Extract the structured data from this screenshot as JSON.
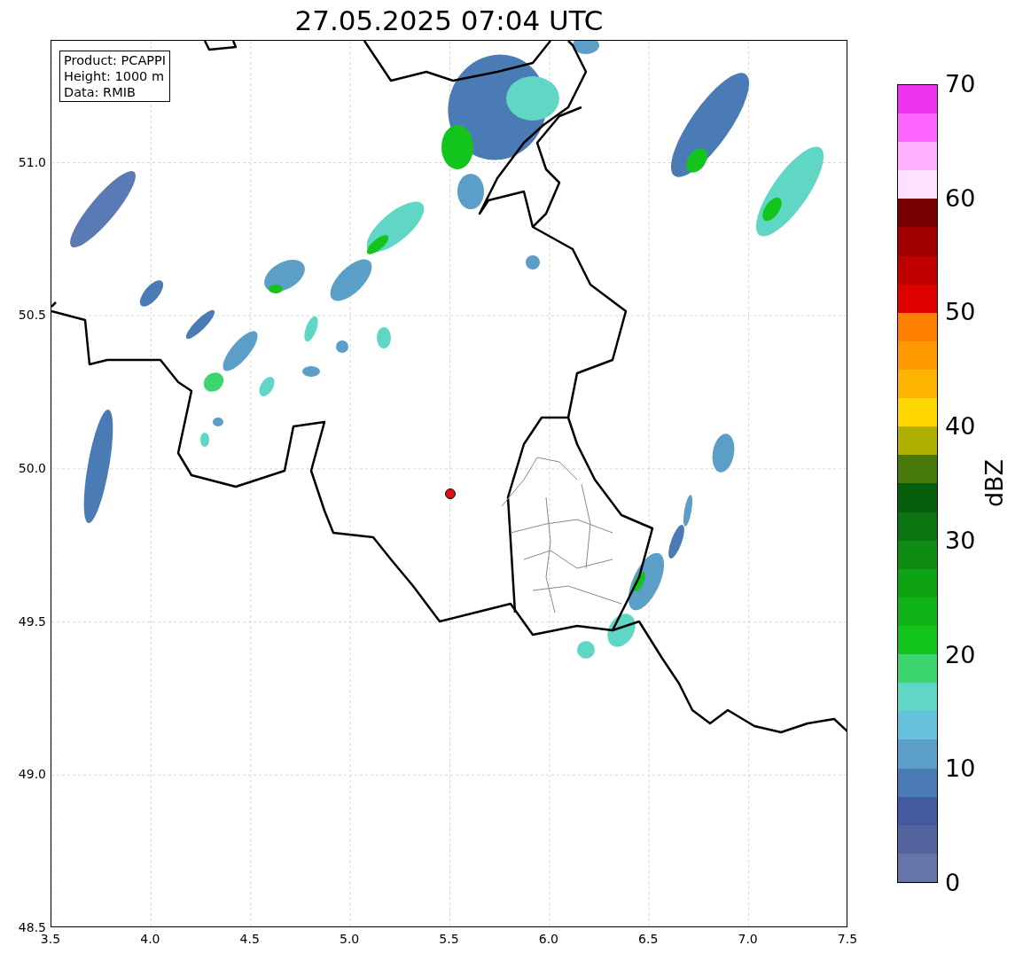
{
  "chart": {
    "title": "27.05.2025 07:04 UTC",
    "info_box": [
      "Product: PCAPPI",
      "Height: 1000 m",
      "Data: RMIB"
    ],
    "x_ticks": [
      "3.5",
      "4.0",
      "4.5",
      "5.0",
      "5.5",
      "6.0",
      "6.5",
      "7.0",
      "7.5"
    ],
    "y_ticks": [
      "51.0",
      "50.5",
      "50.0",
      "49.5",
      "49.0",
      "48.5"
    ]
  },
  "colorbar": {
    "label": "dBZ",
    "ticks": [
      "70",
      "60",
      "50",
      "40",
      "30",
      "20",
      "10",
      "0"
    ],
    "bands": [
      {
        "color": "#6675a8"
      },
      {
        "color": "#53649e"
      },
      {
        "color": "#435aa0"
      },
      {
        "color": "#4a7bb5"
      },
      {
        "color": "#5b9ec8"
      },
      {
        "color": "#65c1dc"
      },
      {
        "color": "#60d6c4"
      },
      {
        "color": "#3dd56f"
      },
      {
        "color": "#12c41c"
      },
      {
        "color": "#10b418"
      },
      {
        "color": "#0fa313"
      },
      {
        "color": "#0e8c12"
      },
      {
        "color": "#0a7410"
      },
      {
        "color": "#075e0d"
      },
      {
        "color": "#477a0a"
      },
      {
        "color": "#b0b000"
      },
      {
        "color": "#ffd700"
      },
      {
        "color": "#ffb400"
      },
      {
        "color": "#ff9900"
      },
      {
        "color": "#ff7f00"
      },
      {
        "color": "#e00000"
      },
      {
        "color": "#c00000"
      },
      {
        "color": "#a00000"
      },
      {
        "color": "#780000"
      },
      {
        "color": "#ffe0ff"
      },
      {
        "color": "#ffb0ff"
      },
      {
        "color": "#ff66ff"
      },
      {
        "color": "#ee33ee"
      }
    ]
  }
}
